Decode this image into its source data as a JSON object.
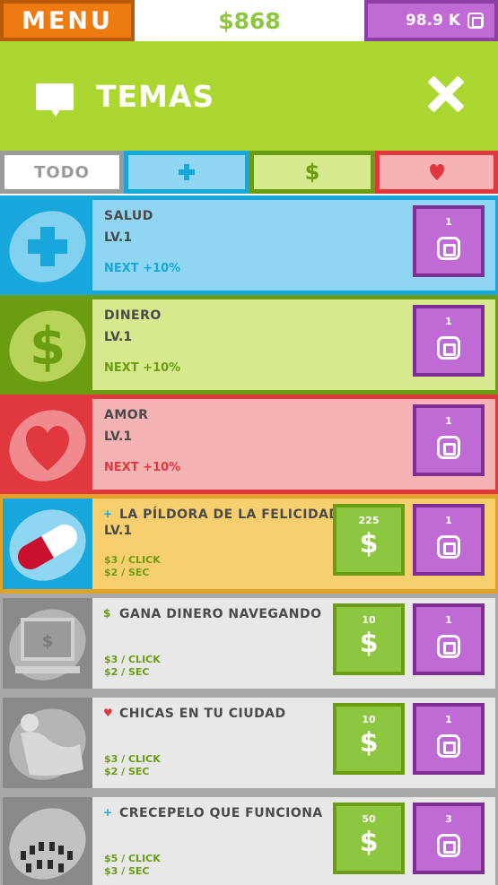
{
  "topbar": {
    "menu_label": "MENU",
    "money": "$868",
    "gems": "98.9 K"
  },
  "header": {
    "title": "TEMAS"
  },
  "tabs": [
    {
      "key": "all",
      "label": "TODO"
    },
    {
      "key": "health",
      "label": "+"
    },
    {
      "key": "money",
      "label": "$"
    },
    {
      "key": "love",
      "label": "heart"
    }
  ],
  "categories": [
    {
      "name": "SALUD",
      "level": "LV.1",
      "next": "NEXT +10%",
      "gem_cost": "1",
      "bg": "#8fd6f2",
      "border": "#18a7dc",
      "accent": "#18a7dc",
      "icon": "plus-icon"
    },
    {
      "name": "DINERO",
      "level": "LV.1",
      "next": "NEXT +10%",
      "gem_cost": "1",
      "bg": "#d6e98f",
      "border": "#6a9d11",
      "accent": "#6a9d11",
      "icon": "dollar-icon"
    },
    {
      "name": "AMOR",
      "level": "LV.1",
      "next": "NEXT +10%",
      "gem_cost": "1",
      "bg": "#f4b4b4",
      "border": "#e0383e",
      "accent": "#e0383e",
      "icon": "heart-icon"
    }
  ],
  "items": [
    {
      "category_sign": "+",
      "name": "LA PÍLDORA DE LA FELICIDAD",
      "level": "LV.1",
      "per_click": "$3 / CLICK",
      "per_sec": "$2 / SEC",
      "cash_cost": "225",
      "gem_cost": "1",
      "bg": "#f7cf6e",
      "border": "#e0a328",
      "icon": "pill-icon"
    },
    {
      "category_sign": "$",
      "name": "GANA DINERO NAVEGANDO",
      "level": "",
      "per_click": "$3 / CLICK",
      "per_sec": "$2 / SEC",
      "cash_cost": "10",
      "gem_cost": "1",
      "bg": "#e8e8e8",
      "border": "#a8a8a8",
      "icon": "computer-icon"
    },
    {
      "category_sign": "♥",
      "name": "CHICAS EN TU CIUDAD",
      "level": "",
      "per_click": "$3 / CLICK",
      "per_sec": "$2 / SEC",
      "cash_cost": "10",
      "gem_cost": "1",
      "bg": "#e8e8e8",
      "border": "#a8a8a8",
      "icon": "girl-icon"
    },
    {
      "category_sign": "+",
      "name": "CRECEPELO QUE FUNCIONA",
      "level": "",
      "per_click": "$5 / CLICK",
      "per_sec": "$3 / SEC",
      "cash_cost": "50",
      "gem_cost": "3",
      "bg": "#e8e8e8",
      "border": "#a8a8a8",
      "icon": "hair-icon"
    }
  ],
  "buy_cash_symbol": "$"
}
